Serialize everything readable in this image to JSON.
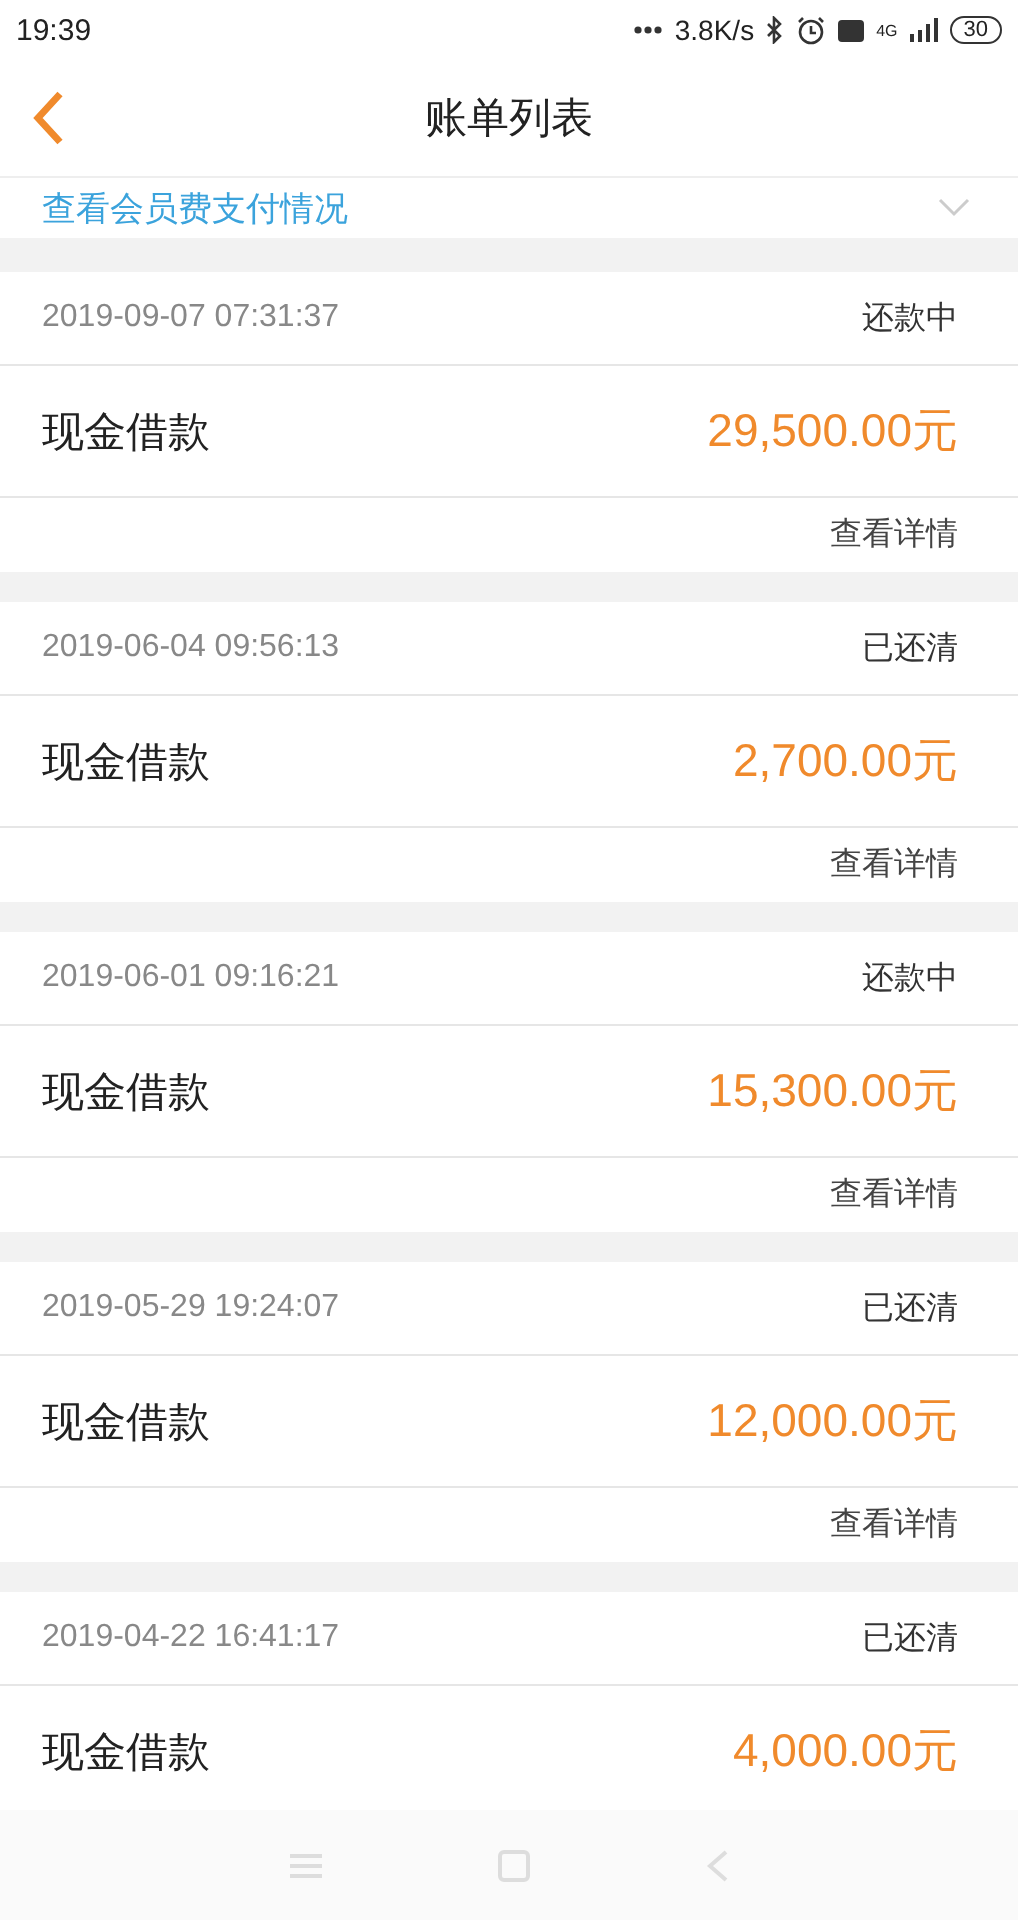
{
  "status_bar": {
    "time": "19:39",
    "speed": "3.8K/s",
    "network": "4G",
    "battery": "30"
  },
  "header": {
    "title": "账单列表"
  },
  "banner": {
    "text": "查看会员费支付情况"
  },
  "bills": [
    {
      "date": "2019-09-07 07:31:37",
      "status": "还款中",
      "name": "现金借款",
      "amount": "29,500.00元",
      "detail": "查看详情"
    },
    {
      "date": "2019-06-04 09:56:13",
      "status": "已还清",
      "name": "现金借款",
      "amount": "2,700.00元",
      "detail": "查看详情"
    },
    {
      "date": "2019-06-01 09:16:21",
      "status": "还款中",
      "name": "现金借款",
      "amount": "15,300.00元",
      "detail": "查看详情"
    },
    {
      "date": "2019-05-29 19:24:07",
      "status": "已还清",
      "name": "现金借款",
      "amount": "12,000.00元",
      "detail": "查看详情"
    },
    {
      "date": "2019-04-22 16:41:17",
      "status": "已还清",
      "name": "现金借款",
      "amount": "4,000.00元"
    }
  ]
}
